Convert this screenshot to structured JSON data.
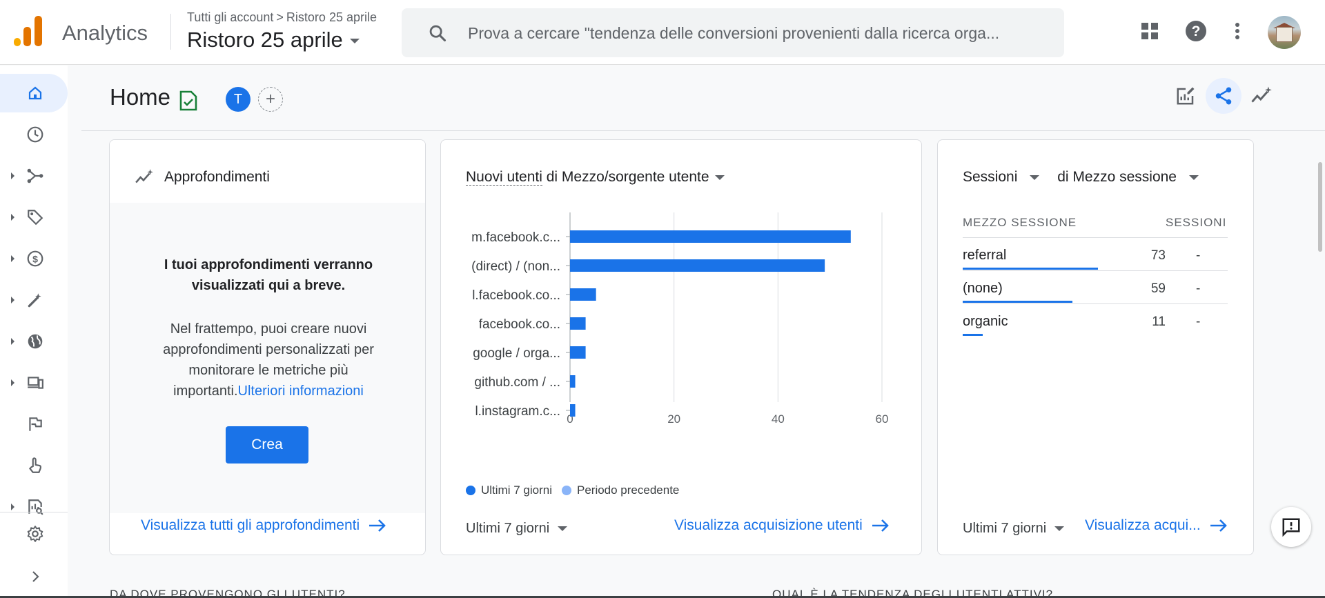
{
  "app": {
    "name": "Analytics",
    "breadcrumb": [
      "Tutti gli account",
      "Ristoro 25 aprile"
    ],
    "property": "Ristoro 25 aprile"
  },
  "search": {
    "placeholder": "Prova a cercare \"tendenza delle conversioni provenienti dalla ricerca orga..."
  },
  "topbar_icons": [
    "apps-grid-icon",
    "help-icon",
    "more-vert-icon",
    "account-avatar"
  ],
  "nav": {
    "items": [
      {
        "name": "home",
        "icon": "home-icon",
        "active": true,
        "expandable": false
      },
      {
        "name": "realtime",
        "icon": "clock-icon",
        "expandable": false
      },
      {
        "name": "acquisition",
        "icon": "acquisition-icon",
        "expandable": true
      },
      {
        "name": "tags",
        "icon": "tag-icon",
        "expandable": true
      },
      {
        "name": "monetization",
        "icon": "dollar-icon",
        "expandable": true
      },
      {
        "name": "advertising",
        "icon": "magic-icon",
        "expandable": true
      },
      {
        "name": "demographics",
        "icon": "globe-icon",
        "expandable": true
      },
      {
        "name": "tech",
        "icon": "devices-icon",
        "expandable": true
      },
      {
        "name": "events",
        "icon": "flag-icon",
        "expandable": false
      },
      {
        "name": "engagement",
        "icon": "touch-icon",
        "expandable": false
      },
      {
        "name": "reports",
        "icon": "report-icon",
        "expandable": true
      }
    ],
    "settings_icon": "gear-icon",
    "collapse_icon": "chevron-right-icon"
  },
  "header": {
    "title": "Home",
    "avatar_letter": "T",
    "add_label": "+"
  },
  "insights": {
    "title": "Approfondimenti",
    "message": "I tuoi approfondimenti verranno visualizzati qui a breve.",
    "body": "Nel frattempo, puoi creare nuovi approfondimenti personalizzati per monitorare le metriche più importanti.",
    "link": "Ulteriori informazioni",
    "button": "Crea",
    "footer_link": "Visualizza tutti gli approfondimenti"
  },
  "acq_card": {
    "title_metric": "Nuovi utenti",
    "title_rest": " di Mezzo/sorgente utente",
    "legend": [
      {
        "label": "Ultimi 7 giorni",
        "color": "#1a73e8"
      },
      {
        "label": "Periodo precedente",
        "color": "#8ab4f8"
      }
    ],
    "period": "Ultimi 7 giorni",
    "footer_link": "Visualizza acquisizione utenti"
  },
  "chart_data": {
    "type": "bar",
    "orientation": "horizontal",
    "categories": [
      "m.facebook.c...",
      "(direct) / (non...",
      "l.facebook.co...",
      "facebook.co...",
      "google / orga...",
      "github.com / ...",
      "l.instagram.c..."
    ],
    "series": [
      {
        "name": "Ultimi 7 giorni",
        "values": [
          54,
          49,
          5,
          3,
          3,
          1,
          1
        ]
      }
    ],
    "xticks": [
      0,
      20,
      40,
      60
    ],
    "xlim": [
      0,
      60
    ],
    "grid": true,
    "legend_position": "bottom"
  },
  "sessions_card": {
    "metric": "Sessioni",
    "dimension": "di Mezzo sessione",
    "col_dim": "MEZZO SESSIONE",
    "col_val": "SESSIONI",
    "rows": [
      {
        "label": "referral",
        "value": "73",
        "change": "-",
        "share": 1.0
      },
      {
        "label": "(none)",
        "value": "59",
        "change": "-",
        "share": 0.81
      },
      {
        "label": "organic",
        "value": "11",
        "change": "-",
        "share": 0.15
      }
    ],
    "period": "Ultimi 7 giorni",
    "footer_link": "Visualizza acqui..."
  },
  "bottom": {
    "left_heading": "DA DOVE PROVENGONO GLI UTENTI?",
    "right_heading": "QUAL È LA TENDENZA DEGLI UTENTI ATTIVI?"
  },
  "colors": {
    "accent": "#1a73e8",
    "brand_orange": "#e37400",
    "brand_yellow": "#f9ab00",
    "success_green": "#188038"
  }
}
